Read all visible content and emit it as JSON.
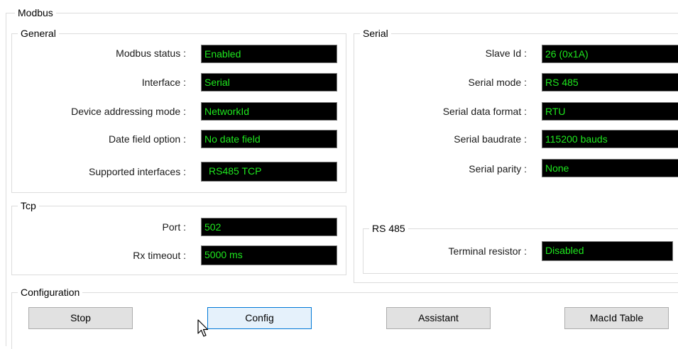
{
  "modbus": {
    "title": "Modbus"
  },
  "general": {
    "title": "General",
    "fields": [
      {
        "label": "Modbus status :",
        "value": "Enabled"
      },
      {
        "label": "Interface :",
        "value": "Serial"
      },
      {
        "label": "Device addressing mode :",
        "value": "NetworkId"
      },
      {
        "label": "Date field option :",
        "value": "No date field"
      },
      {
        "label": "Supported interfaces :",
        "value": "RS485 TCP"
      }
    ]
  },
  "tcp": {
    "title": "Tcp",
    "fields": [
      {
        "label": "Port :",
        "value": "502"
      },
      {
        "label": "Rx timeout :",
        "value": "5000 ms"
      }
    ]
  },
  "serial": {
    "title": "Serial",
    "fields": [
      {
        "label": "Slave Id :",
        "value": "26 (0x1A)"
      },
      {
        "label": "Serial mode :",
        "value": "RS 485"
      },
      {
        "label": "Serial data format :",
        "value": "RTU"
      },
      {
        "label": "Serial baudrate :",
        "value": "115200 bauds"
      },
      {
        "label": "Serial parity :",
        "value": "None"
      }
    ]
  },
  "rs485": {
    "title": "RS 485",
    "fields": [
      {
        "label": "Terminal resistor :",
        "value": "Disabled"
      }
    ]
  },
  "configuration": {
    "title": "Configuration",
    "buttons": {
      "stop": "Stop",
      "config": "Config",
      "assistant": "Assistant",
      "macid_table": "MacId Table"
    }
  },
  "colors": {
    "field_bg": "#000000",
    "field_text": "#1ee81e",
    "focus_border": "#0078d7"
  },
  "icons": {
    "cursor": "mouse-pointer-icon"
  }
}
